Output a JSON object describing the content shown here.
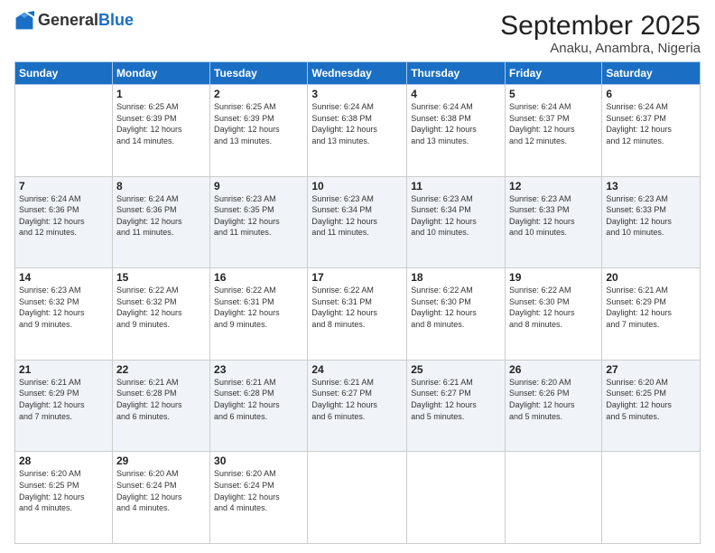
{
  "logo": {
    "general": "General",
    "blue": "Blue"
  },
  "title": "September 2025",
  "subtitle": "Anaku, Anambra, Nigeria",
  "days_of_week": [
    "Sunday",
    "Monday",
    "Tuesday",
    "Wednesday",
    "Thursday",
    "Friday",
    "Saturday"
  ],
  "weeks": [
    [
      {
        "num": "",
        "info": ""
      },
      {
        "num": "1",
        "info": "Sunrise: 6:25 AM\nSunset: 6:39 PM\nDaylight: 12 hours\nand 14 minutes."
      },
      {
        "num": "2",
        "info": "Sunrise: 6:25 AM\nSunset: 6:39 PM\nDaylight: 12 hours\nand 13 minutes."
      },
      {
        "num": "3",
        "info": "Sunrise: 6:24 AM\nSunset: 6:38 PM\nDaylight: 12 hours\nand 13 minutes."
      },
      {
        "num": "4",
        "info": "Sunrise: 6:24 AM\nSunset: 6:38 PM\nDaylight: 12 hours\nand 13 minutes."
      },
      {
        "num": "5",
        "info": "Sunrise: 6:24 AM\nSunset: 6:37 PM\nDaylight: 12 hours\nand 12 minutes."
      },
      {
        "num": "6",
        "info": "Sunrise: 6:24 AM\nSunset: 6:37 PM\nDaylight: 12 hours\nand 12 minutes."
      }
    ],
    [
      {
        "num": "7",
        "info": "Sunrise: 6:24 AM\nSunset: 6:36 PM\nDaylight: 12 hours\nand 12 minutes."
      },
      {
        "num": "8",
        "info": "Sunrise: 6:24 AM\nSunset: 6:36 PM\nDaylight: 12 hours\nand 11 minutes."
      },
      {
        "num": "9",
        "info": "Sunrise: 6:23 AM\nSunset: 6:35 PM\nDaylight: 12 hours\nand 11 minutes."
      },
      {
        "num": "10",
        "info": "Sunrise: 6:23 AM\nSunset: 6:34 PM\nDaylight: 12 hours\nand 11 minutes."
      },
      {
        "num": "11",
        "info": "Sunrise: 6:23 AM\nSunset: 6:34 PM\nDaylight: 12 hours\nand 10 minutes."
      },
      {
        "num": "12",
        "info": "Sunrise: 6:23 AM\nSunset: 6:33 PM\nDaylight: 12 hours\nand 10 minutes."
      },
      {
        "num": "13",
        "info": "Sunrise: 6:23 AM\nSunset: 6:33 PM\nDaylight: 12 hours\nand 10 minutes."
      }
    ],
    [
      {
        "num": "14",
        "info": "Sunrise: 6:23 AM\nSunset: 6:32 PM\nDaylight: 12 hours\nand 9 minutes."
      },
      {
        "num": "15",
        "info": "Sunrise: 6:22 AM\nSunset: 6:32 PM\nDaylight: 12 hours\nand 9 minutes."
      },
      {
        "num": "16",
        "info": "Sunrise: 6:22 AM\nSunset: 6:31 PM\nDaylight: 12 hours\nand 9 minutes."
      },
      {
        "num": "17",
        "info": "Sunrise: 6:22 AM\nSunset: 6:31 PM\nDaylight: 12 hours\nand 8 minutes."
      },
      {
        "num": "18",
        "info": "Sunrise: 6:22 AM\nSunset: 6:30 PM\nDaylight: 12 hours\nand 8 minutes."
      },
      {
        "num": "19",
        "info": "Sunrise: 6:22 AM\nSunset: 6:30 PM\nDaylight: 12 hours\nand 8 minutes."
      },
      {
        "num": "20",
        "info": "Sunrise: 6:21 AM\nSunset: 6:29 PM\nDaylight: 12 hours\nand 7 minutes."
      }
    ],
    [
      {
        "num": "21",
        "info": "Sunrise: 6:21 AM\nSunset: 6:29 PM\nDaylight: 12 hours\nand 7 minutes."
      },
      {
        "num": "22",
        "info": "Sunrise: 6:21 AM\nSunset: 6:28 PM\nDaylight: 12 hours\nand 6 minutes."
      },
      {
        "num": "23",
        "info": "Sunrise: 6:21 AM\nSunset: 6:28 PM\nDaylight: 12 hours\nand 6 minutes."
      },
      {
        "num": "24",
        "info": "Sunrise: 6:21 AM\nSunset: 6:27 PM\nDaylight: 12 hours\nand 6 minutes."
      },
      {
        "num": "25",
        "info": "Sunrise: 6:21 AM\nSunset: 6:27 PM\nDaylight: 12 hours\nand 5 minutes."
      },
      {
        "num": "26",
        "info": "Sunrise: 6:20 AM\nSunset: 6:26 PM\nDaylight: 12 hours\nand 5 minutes."
      },
      {
        "num": "27",
        "info": "Sunrise: 6:20 AM\nSunset: 6:25 PM\nDaylight: 12 hours\nand 5 minutes."
      }
    ],
    [
      {
        "num": "28",
        "info": "Sunrise: 6:20 AM\nSunset: 6:25 PM\nDaylight: 12 hours\nand 4 minutes."
      },
      {
        "num": "29",
        "info": "Sunrise: 6:20 AM\nSunset: 6:24 PM\nDaylight: 12 hours\nand 4 minutes."
      },
      {
        "num": "30",
        "info": "Sunrise: 6:20 AM\nSunset: 6:24 PM\nDaylight: 12 hours\nand 4 minutes."
      },
      {
        "num": "",
        "info": ""
      },
      {
        "num": "",
        "info": ""
      },
      {
        "num": "",
        "info": ""
      },
      {
        "num": "",
        "info": ""
      }
    ]
  ]
}
